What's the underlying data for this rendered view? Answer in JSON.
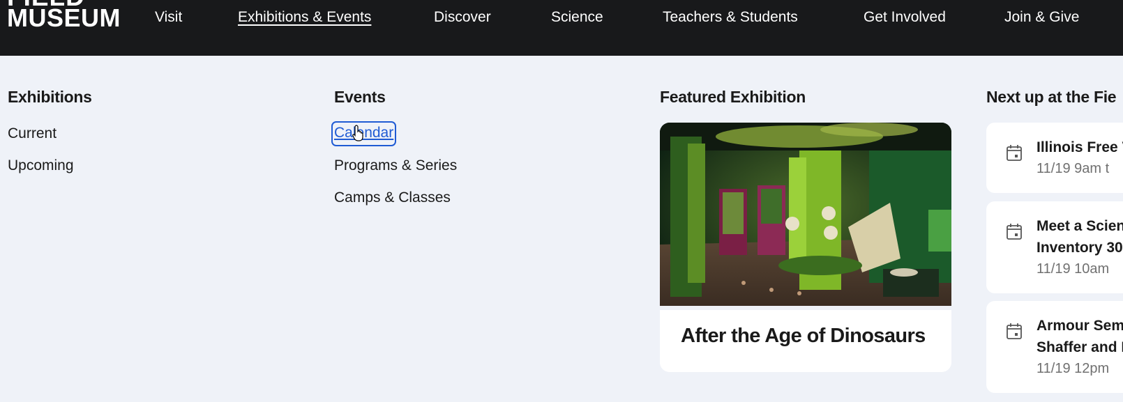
{
  "logo": {
    "line1": "FIELD",
    "line2": "MUSEUM"
  },
  "nav": {
    "items": [
      {
        "label": "Visit"
      },
      {
        "label": "Exhibitions & Events",
        "active": true
      },
      {
        "label": "Discover"
      },
      {
        "label": "Science"
      },
      {
        "label": "Teachers & Students"
      },
      {
        "label": "Get Involved"
      },
      {
        "label": "Join & Give"
      }
    ]
  },
  "menu": {
    "exhibitions": {
      "heading": "Exhibitions",
      "links": [
        "Current",
        "Upcoming"
      ]
    },
    "events": {
      "heading": "Events",
      "links": [
        "Calendar",
        "Programs & Series",
        "Camps & Classes"
      ]
    },
    "featured": {
      "heading": "Featured Exhibition",
      "title": "After the Age of Dinosaurs"
    },
    "next_up": {
      "heading": "Next up at the Fie",
      "events": [
        {
          "title_lines": [
            "Illinois Free V"
          ],
          "time": "11/19 9am t"
        },
        {
          "title_lines": [
            "Meet a Scien",
            "Inventory 30"
          ],
          "time": "11/19 10am"
        },
        {
          "title_lines": [
            "Armour Sem",
            "Shaffer and I"
          ],
          "time": "11/19 12pm"
        }
      ]
    }
  },
  "colors": {
    "nav_bg": "#18191b",
    "page_bg": "#eff2f8",
    "link_focus": "#1f5bd4",
    "muted_text": "#707070"
  },
  "icons": {
    "event_icon": "calendar-icon"
  }
}
